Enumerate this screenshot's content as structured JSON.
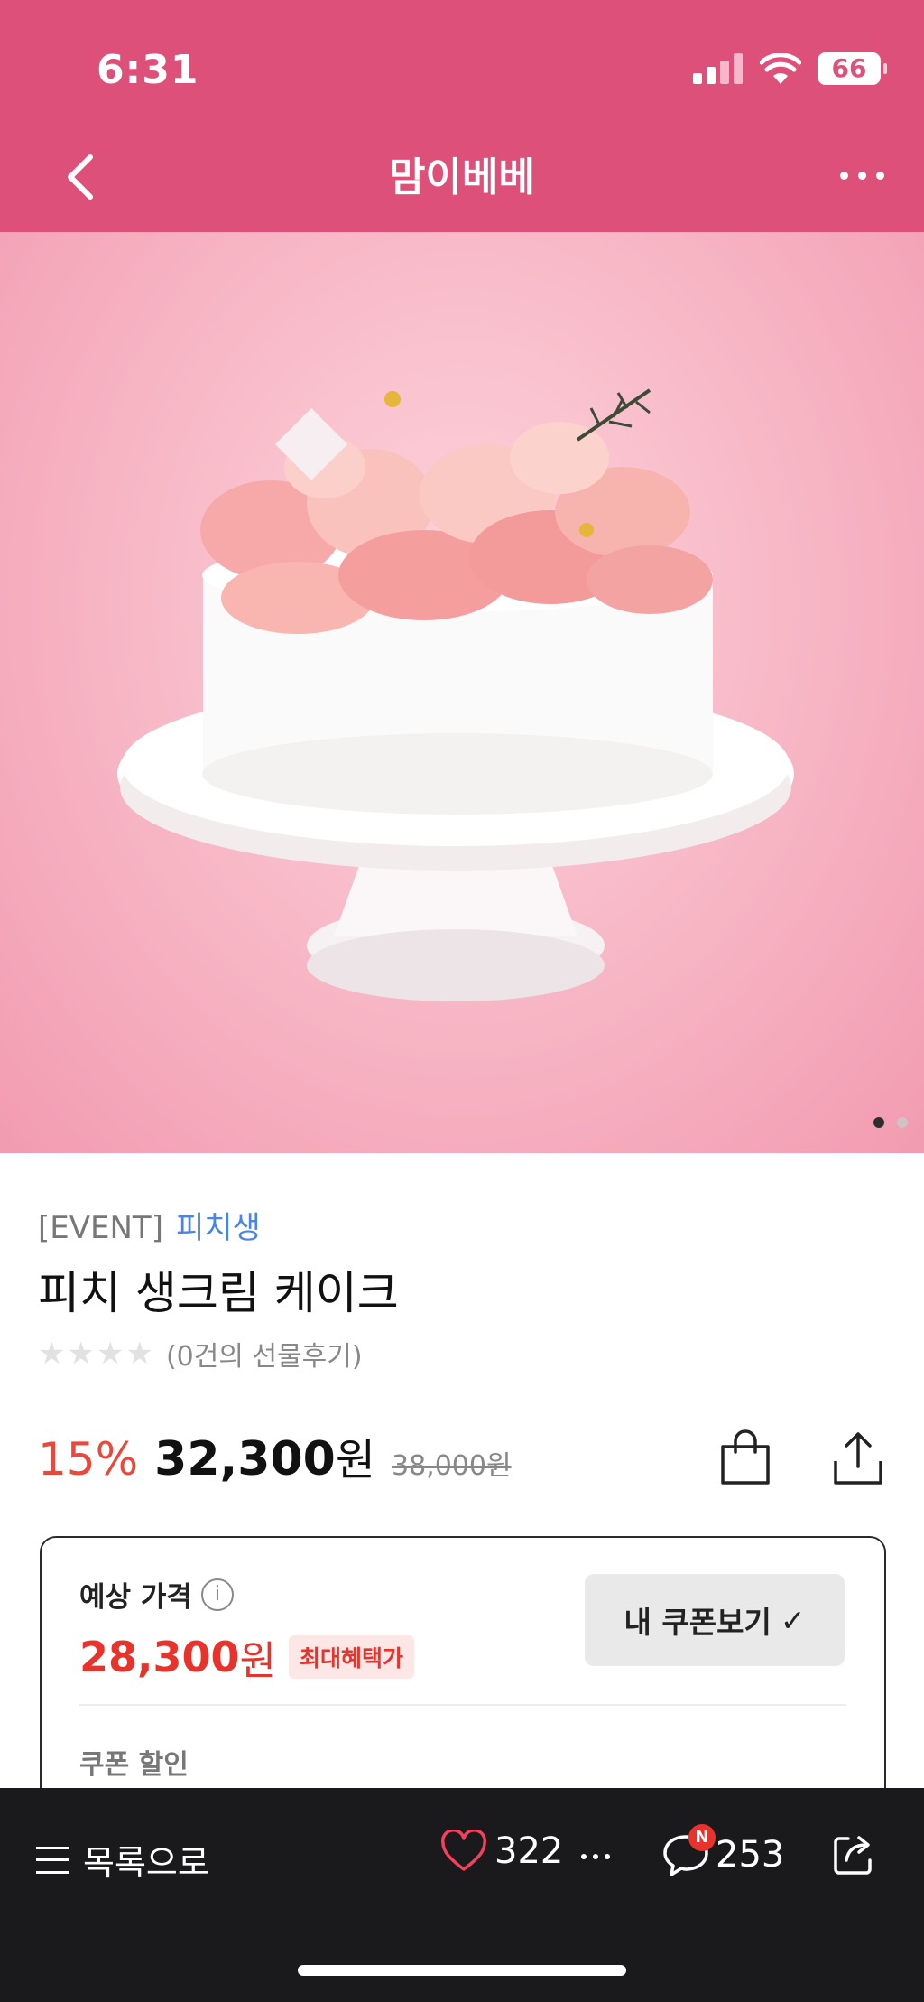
{
  "status_bar": {
    "time": "6:31",
    "battery": "66"
  },
  "nav": {
    "title": "맘이베베"
  },
  "gallery": {
    "page_count": 2,
    "active_page": 1
  },
  "product": {
    "category_event": "[EVENT]",
    "category_tag": "피치생",
    "title": "피치 생크림 케이크",
    "rating_stars": 0,
    "review_text": "(0건의 선물후기)",
    "discount": "15%",
    "price": "32,300",
    "price_unit": "원",
    "original_price": "38,000원"
  },
  "estimate": {
    "label": "예상 가격",
    "info_glyph": "i",
    "price": "28,300",
    "price_unit": "원",
    "badge": "최대혜택가",
    "coupon_button": "내 쿠폰보기",
    "coupon_check": "✓",
    "coupon_discount_label": "쿠폰 할인"
  },
  "bottom_bar": {
    "list_label": "목록으로",
    "likes": "322",
    "comments": "253",
    "new_badge": "N"
  },
  "colors": {
    "brand": "#dd5079",
    "sale_red": "#e8322c",
    "link_blue": "#4a84e6",
    "bottom_bar": "#1a1a1c"
  }
}
